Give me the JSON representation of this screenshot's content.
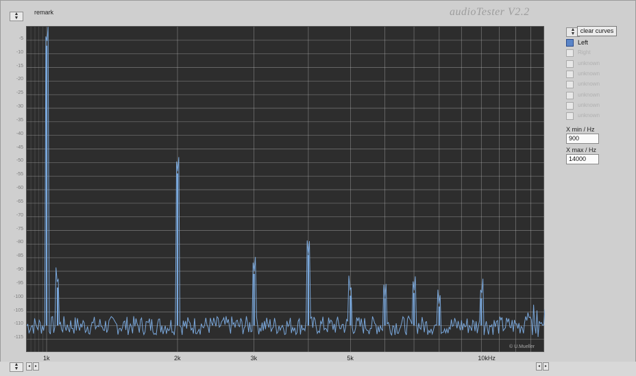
{
  "header": {
    "remark_label": "remark",
    "app_title": "audioTester V2.2"
  },
  "controls": {
    "clear_curves_label": "clear curves",
    "channels": [
      {
        "label": "Left",
        "checked": true,
        "active": true
      },
      {
        "label": "Right",
        "checked": false,
        "active": false
      },
      {
        "label": "unknown",
        "checked": false,
        "active": false
      },
      {
        "label": "unknown",
        "checked": false,
        "active": false
      },
      {
        "label": "unknown",
        "checked": false,
        "active": false
      },
      {
        "label": "unknown",
        "checked": false,
        "active": false
      },
      {
        "label": "unknown",
        "checked": false,
        "active": false
      },
      {
        "label": "unknown",
        "checked": false,
        "active": false
      }
    ],
    "x_min_label": "X min / Hz",
    "x_min_value": "900",
    "x_max_label": "X max / Hz",
    "x_max_value": "14000"
  },
  "plot": {
    "copyright": "© U.Mueller",
    "trace_color": "#7aa8dc",
    "grid_color": "#b8b8b8"
  },
  "chart_data": {
    "type": "line",
    "xscale": "log",
    "xlim": [
      900,
      14000
    ],
    "ylim": [
      -120,
      0
    ],
    "x_tick_labels": [
      {
        "value": 1000,
        "label": "1k"
      },
      {
        "value": 2000,
        "label": "2k"
      },
      {
        "value": 3000,
        "label": "3k"
      },
      {
        "value": 5000,
        "label": "5k"
      },
      {
        "value": 10000,
        "label": "10kHz"
      }
    ],
    "y_tick_labels": [
      "-5",
      "-10",
      "-15",
      "-20",
      "-25",
      "-30",
      "-35",
      "-40",
      "-45",
      "-50",
      "-55",
      "-60",
      "-65",
      "-70",
      "-75",
      "-80",
      "-85",
      "-90",
      "-95",
      "-100",
      "-105",
      "-110",
      "-115"
    ],
    "noise_floor": -110,
    "peaks": [
      {
        "x": 1000,
        "y": -7
      },
      {
        "x": 1060,
        "y": -96
      },
      {
        "x": 2000,
        "y": -54
      },
      {
        "x": 3000,
        "y": -91
      },
      {
        "x": 4000,
        "y": -84
      },
      {
        "x": 5000,
        "y": -99
      },
      {
        "x": 6000,
        "y": -100
      },
      {
        "x": 7000,
        "y": -98
      },
      {
        "x": 8000,
        "y": -103
      },
      {
        "x": 10000,
        "y": -100
      }
    ],
    "grid": true
  }
}
